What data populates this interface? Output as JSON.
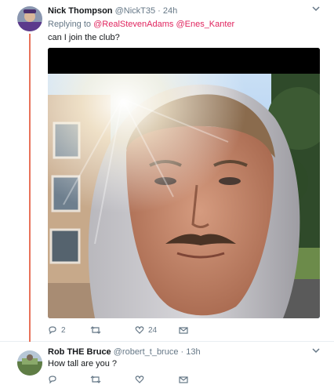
{
  "tweet1": {
    "name": "Nick Thompson",
    "handle": "@NickT35",
    "separator": "·",
    "time": "24h",
    "replying_label": "Replying to",
    "reply_to": [
      "@RealStevenAdams",
      "@Enes_Kanter"
    ],
    "text": "can I join the club?",
    "actions": {
      "reply_count": "2",
      "retweet_count": "",
      "like_count": "24"
    },
    "icons": [
      "avatar",
      "caret-down-icon",
      "reply-icon",
      "retweet-icon",
      "heart-icon",
      "mail-icon"
    ]
  },
  "tweet2": {
    "name": "Rob THE Bruce",
    "handle": "@robert_t_bruce",
    "separator": "·",
    "time": "13h",
    "text": "How tall are you ?",
    "icons": [
      "avatar",
      "caret-down-icon",
      "reply-icon",
      "retweet-icon",
      "heart-icon",
      "mail-icon"
    ]
  },
  "colors": {
    "thread_line": "#e8735a",
    "mention": "#e0245e",
    "muted": "#657786",
    "background": "#e9eef2"
  }
}
